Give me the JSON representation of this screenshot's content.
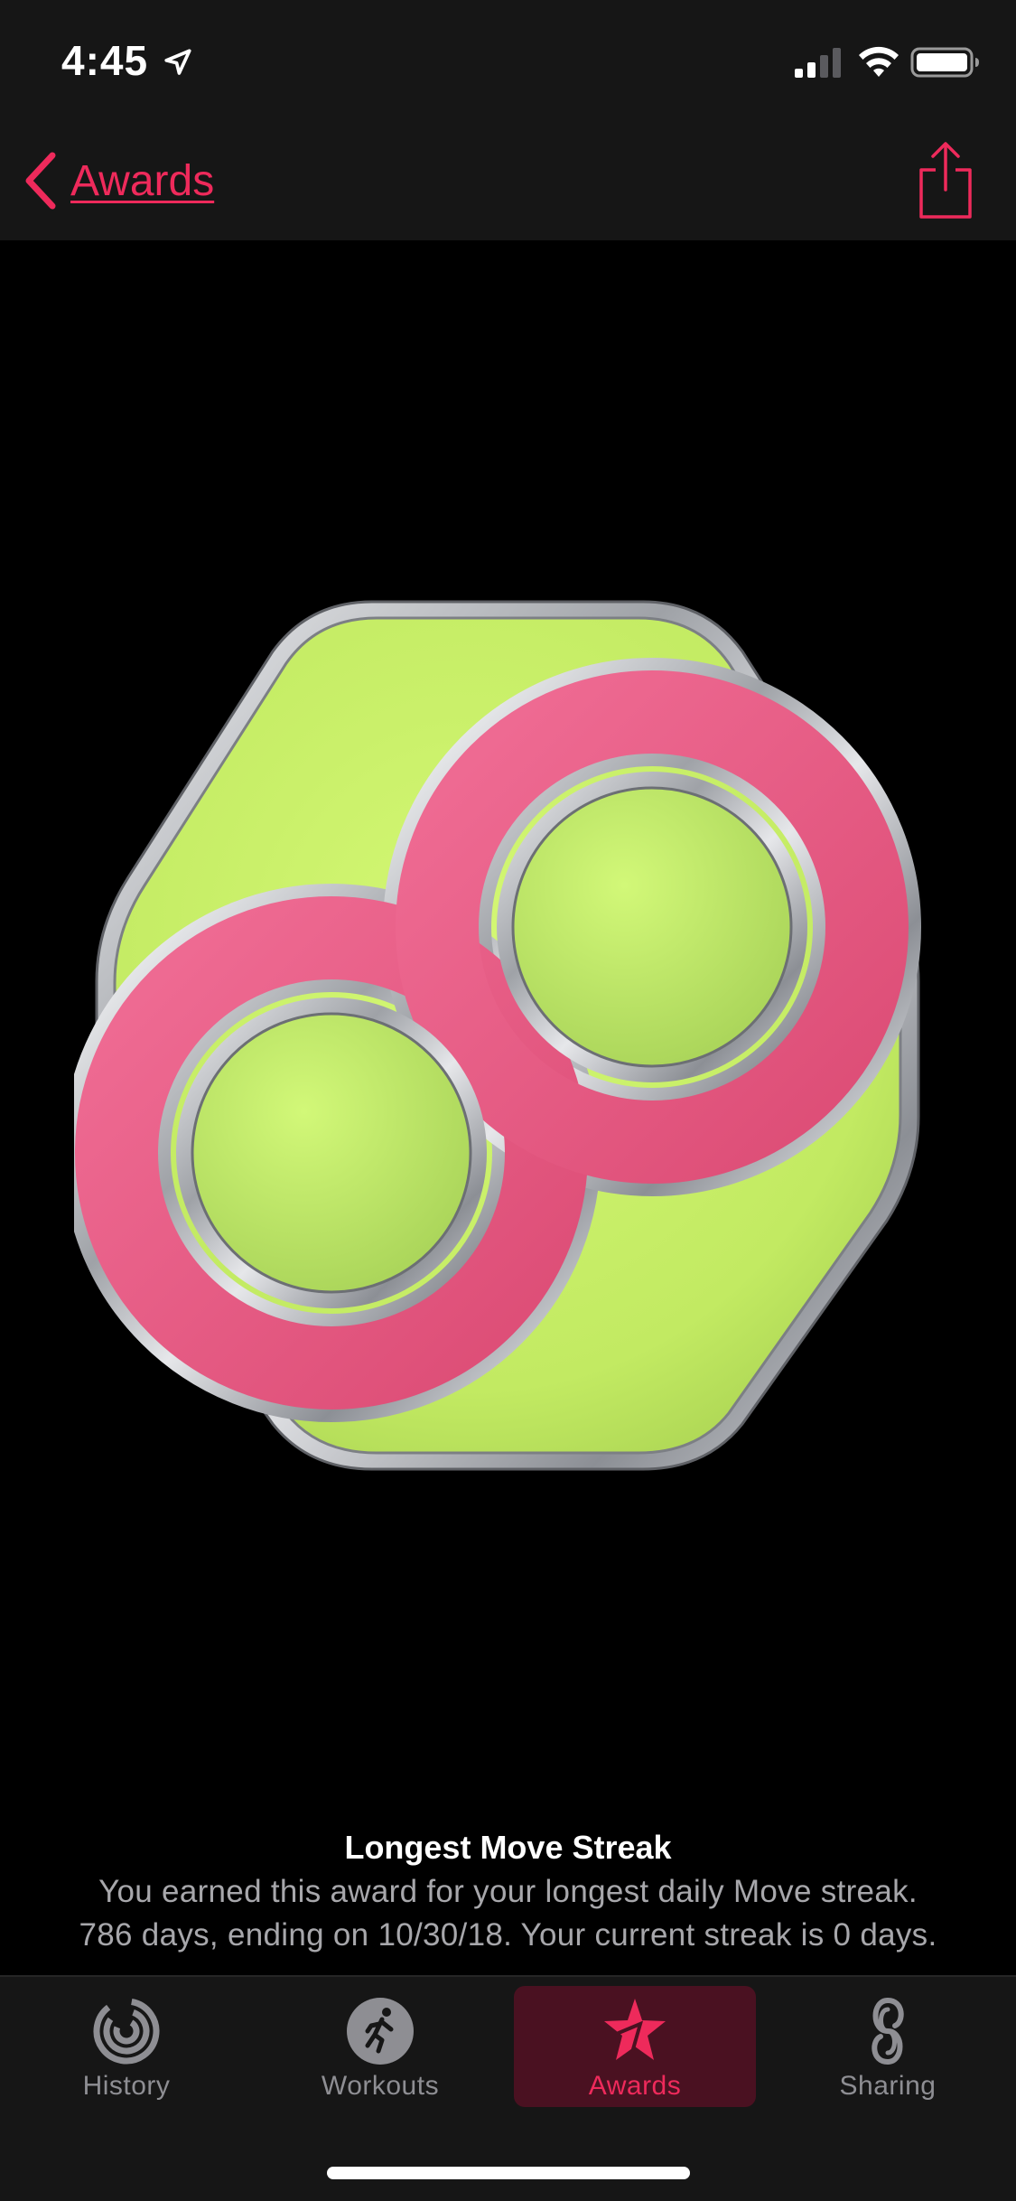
{
  "status_bar": {
    "time": "4:45",
    "icons": [
      "location-arrow-icon",
      "cellular-signal-icon",
      "wifi-icon",
      "battery-icon"
    ]
  },
  "nav": {
    "back_label": "Awards",
    "back_icon": "chevron-left-icon",
    "share_icon": "share-icon"
  },
  "award": {
    "title": "Longest Move Streak",
    "description_line1": "You earned this award for your longest daily Move streak.",
    "description_line2": "786 days, ending on 10/30/18. Your current streak is 0 days.",
    "badge_icon": "infinity-badge-icon"
  },
  "tabs": [
    {
      "label": "History",
      "icon": "history-rings-icon",
      "selected": false
    },
    {
      "label": "Workouts",
      "icon": "runner-icon",
      "selected": false
    },
    {
      "label": "Awards",
      "icon": "award-star-icon",
      "selected": true
    },
    {
      "label": "Sharing",
      "icon": "sharing-icon",
      "selected": false
    }
  ],
  "colors": {
    "accent": "#ee2a5b",
    "bar_background": "#161616",
    "badge_green": "#c8f060",
    "badge_pink": "#ec5a86",
    "badge_silver": "#c7c9cc",
    "inactive_tab": "#8e8e93"
  }
}
